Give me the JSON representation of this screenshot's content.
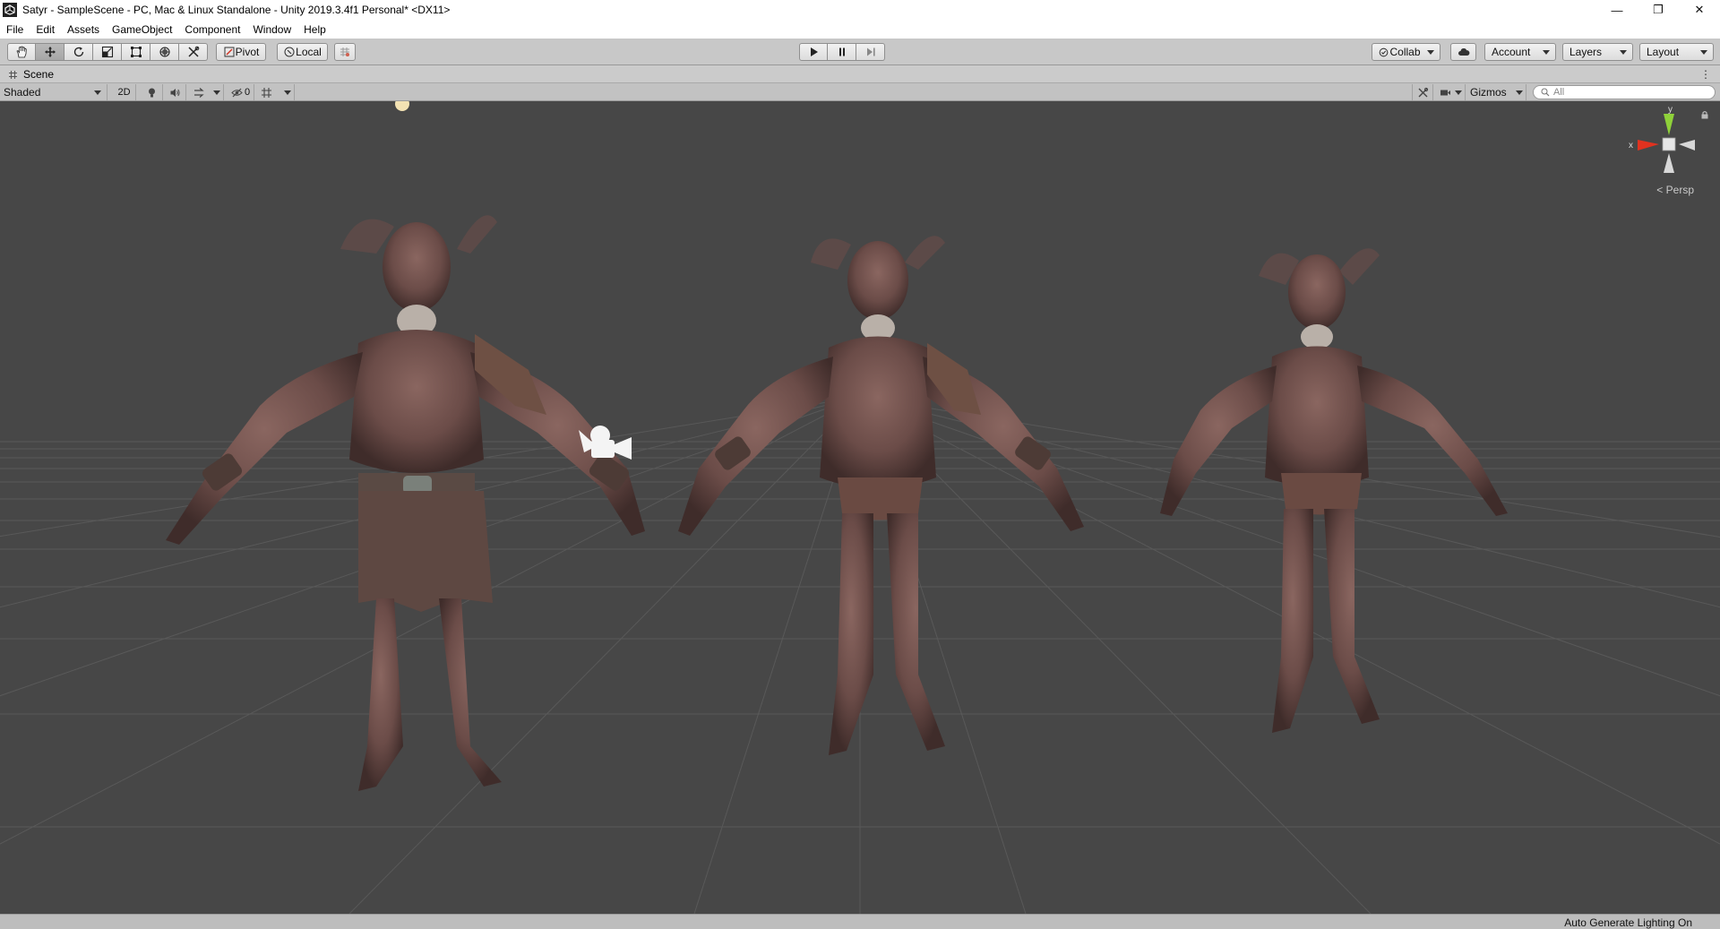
{
  "window": {
    "title": "Satyr - SampleScene - PC, Mac & Linux Standalone - Unity 2019.3.4f1 Personal* <DX11>",
    "controls": [
      "minimize-icon",
      "restore-icon",
      "close-icon"
    ]
  },
  "menu": [
    "File",
    "Edit",
    "Assets",
    "GameObject",
    "Component",
    "Window",
    "Help"
  ],
  "toolbar": {
    "tools": [
      "hand-tool-icon",
      "move-tool-icon",
      "rotate-tool-icon",
      "scale-tool-icon",
      "rect-tool-icon",
      "transform-tool-icon",
      "custom-tool-icon"
    ],
    "active_tool": "move-tool-icon",
    "pivot_label": "Pivot",
    "local_label": "Local",
    "playback": [
      "play-icon",
      "pause-icon",
      "step-icon"
    ],
    "collab_label": "Collab",
    "account_label": "Account",
    "layers_label": "Layers",
    "layout_label": "Layout"
  },
  "scene_tab": {
    "label": "Scene"
  },
  "scene_options": {
    "draw_mode": "Shaded",
    "two_d_label": "2D",
    "hidden_count": "0",
    "gizmos_label": "Gizmos",
    "search_placeholder": "All"
  },
  "viewport": {
    "background_color": "#474747",
    "projection_label": "Persp",
    "axis_x_label": "x",
    "axis_y_label": "y",
    "axis_x_color": "#e0321f",
    "axis_y_color": "#8fd13a",
    "models": [
      "satyr-full-outfit",
      "satyr-loincloth-bracers",
      "satyr-loincloth"
    ]
  },
  "status": {
    "message": "Auto Generate Lighting On"
  }
}
